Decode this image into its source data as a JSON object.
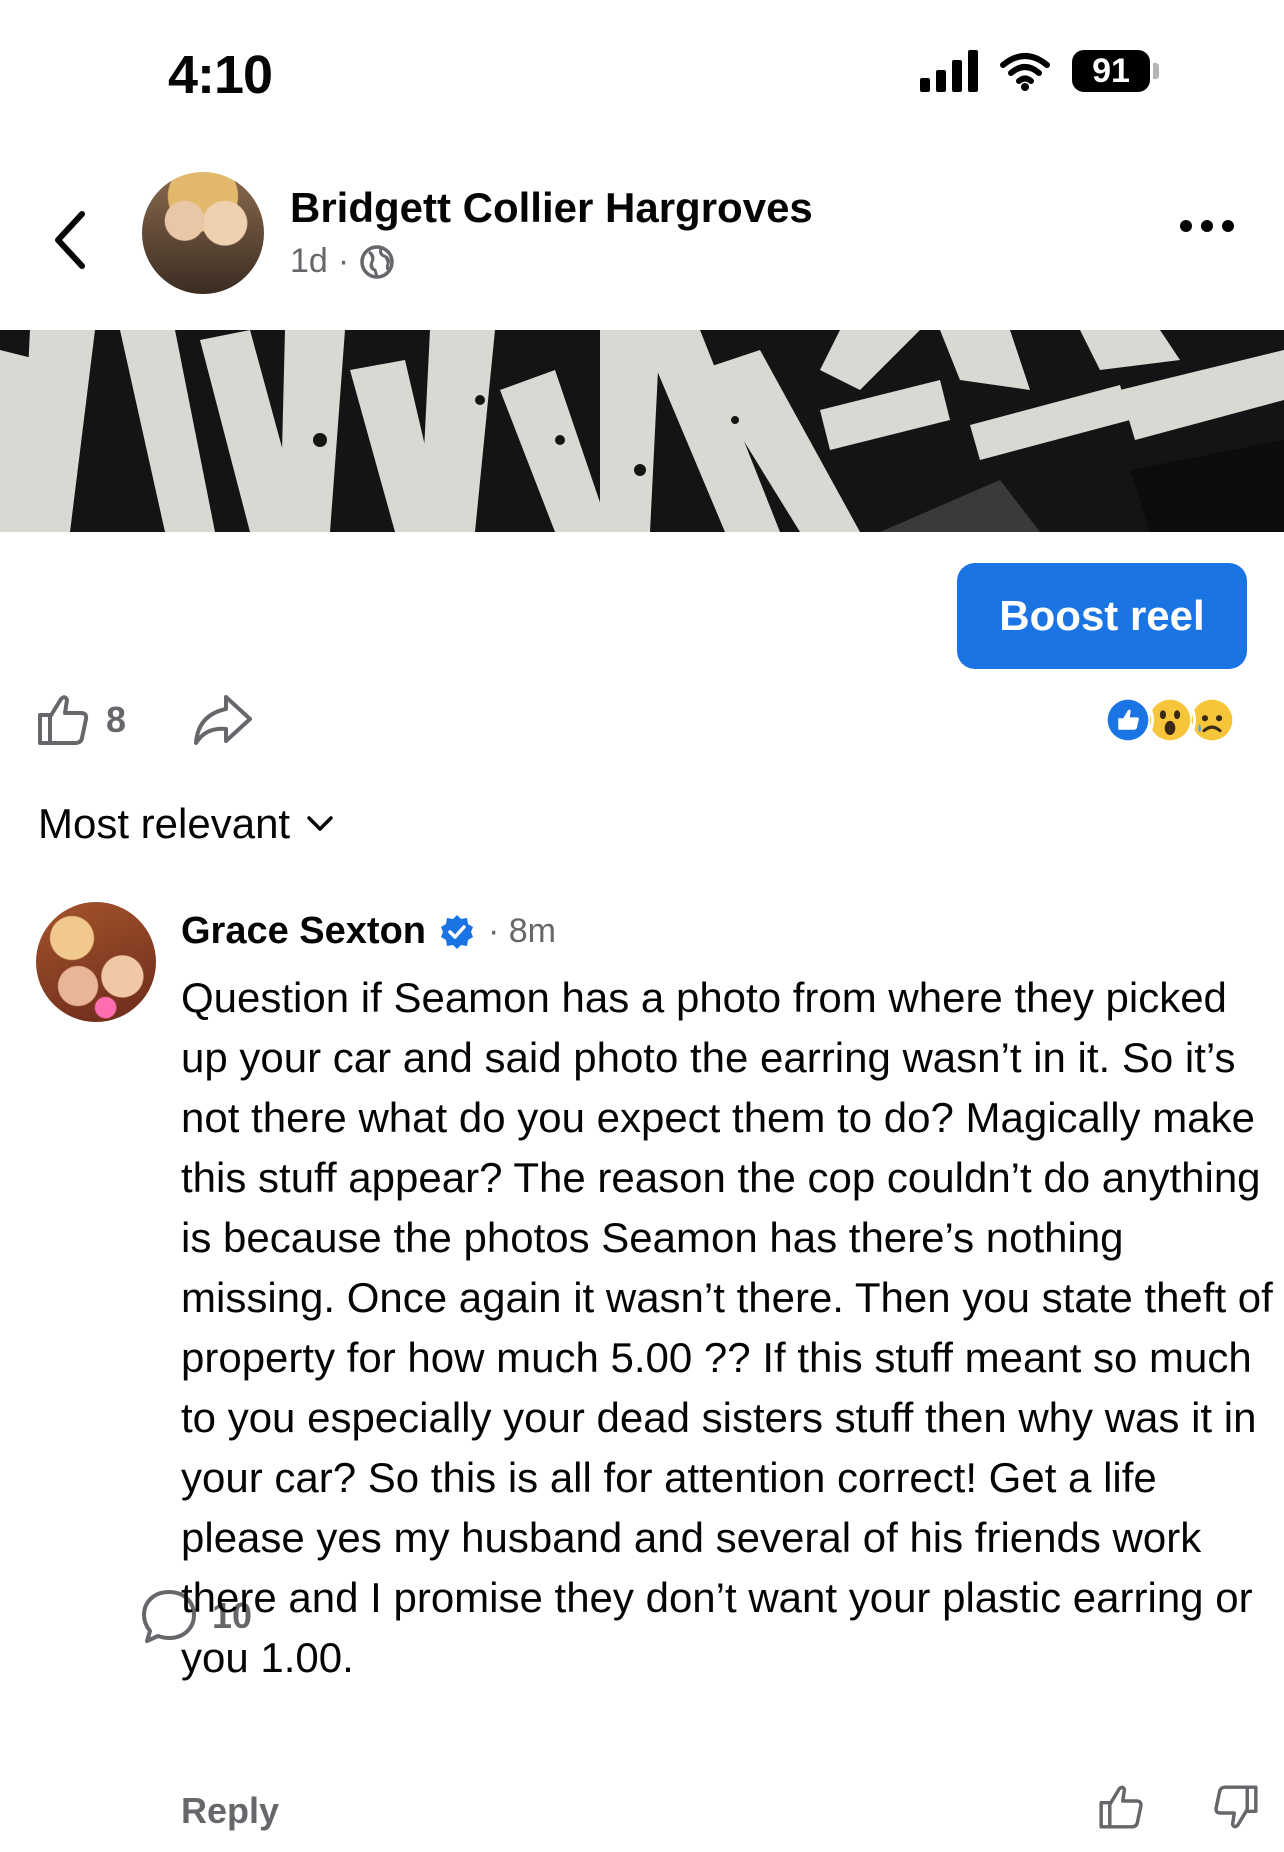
{
  "status_bar": {
    "time": "4:10",
    "battery": "91",
    "icons": [
      "signal-icon",
      "wifi-icon",
      "battery-icon"
    ]
  },
  "header": {
    "back_icon": "chevron-left-icon",
    "poster_name": "Bridgett Collier Hargroves",
    "post_age": "1d",
    "separator": "·",
    "privacy_icon": "globe-icon",
    "more_icon": "more-horizontal-icon"
  },
  "boost": {
    "label": "Boost reel",
    "color": "#1b74e4"
  },
  "actions": {
    "like_count": "8",
    "comment_count": "10",
    "like_icon": "thumbs-up-icon",
    "comment_icon": "comment-bubble-icon",
    "share_icon": "share-arrow-icon",
    "reactions": [
      "like-reaction-icon",
      "wow-reaction-icon",
      "sad-reaction-icon"
    ]
  },
  "sort": {
    "label": "Most relevant",
    "icon": "chevron-down-icon"
  },
  "comment": {
    "name": "Grace Sexton",
    "verified_icon": "verified-badge-icon",
    "time": "· 8m",
    "text": "Question if Seamon has a photo from where they picked up your car and said photo the earring wasn’t in it.  So it’s not there what do you expect them to do? Magically make this stuff appear? The reason the cop couldn’t do anything is because the photos Seamon has there’s nothing missing. Once again it wasn’t there. Then you state theft of property for how much 5.00 ?? If this stuff meant so much to you especially your dead sisters stuff then why was it in your car? So this is all for attention correct! Get a life please yes my husband and several of his friends work there and I promise they don’t want your plastic earring or you 1.00.",
    "reply_label": "Reply",
    "upvote_icon": "thumbs-up-icon",
    "downvote_icon": "thumbs-down-icon"
  },
  "colors": {
    "text_primary": "#050505",
    "text_secondary": "#65676b",
    "accent": "#1b74e4"
  }
}
